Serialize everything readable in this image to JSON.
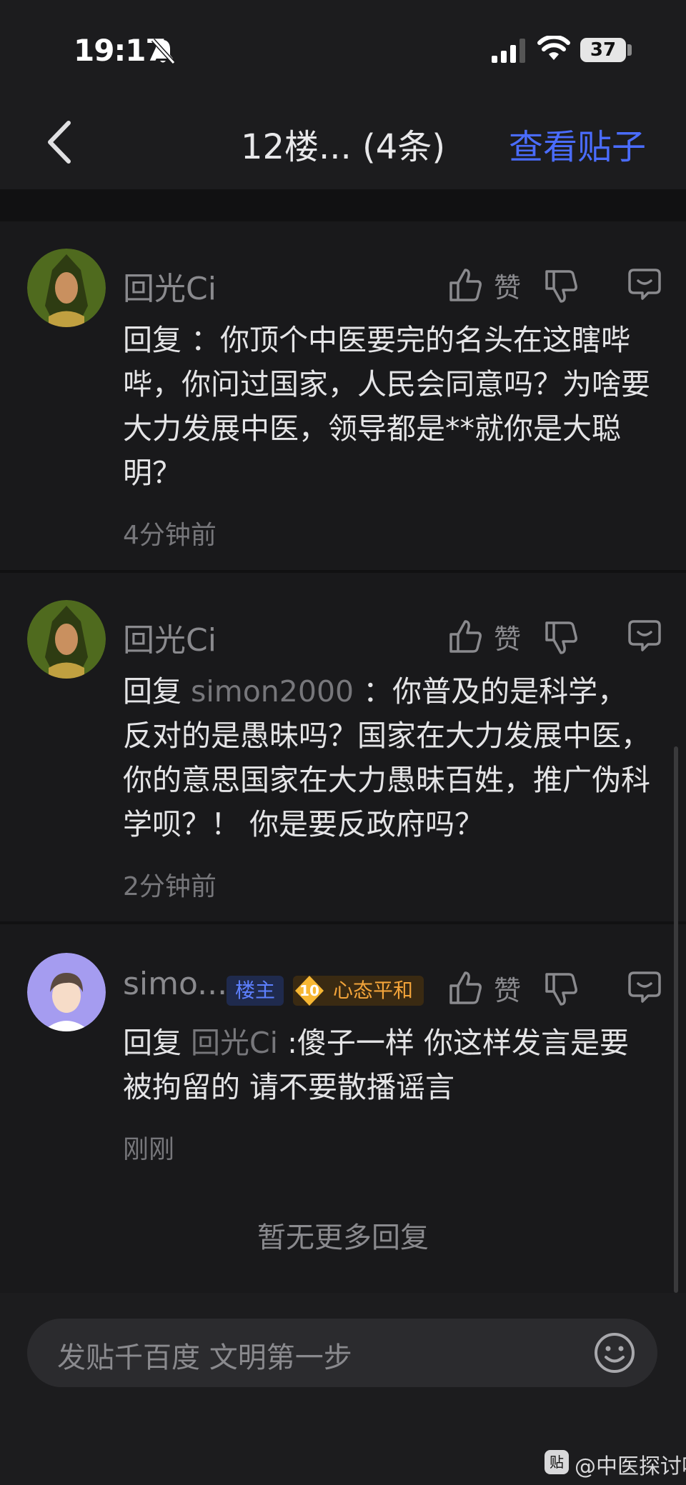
{
  "status": {
    "time": "19:17",
    "battery": "37"
  },
  "nav": {
    "title": "12楼... (4条)",
    "view_post": "查看贴子"
  },
  "comments": [
    {
      "username": "回光Ci",
      "like_label": "赞",
      "reply_prefix": "回复",
      "mention": "",
      "text": " ：你顶个中医要完的名头在这瞎哔哔，你问过国家，人民会同意吗？为啥要大力发展中医，领导都是**就你是大聪明？",
      "time": "4分钟前"
    },
    {
      "username": "回光Ci",
      "like_label": "赞",
      "reply_prefix": "回复",
      "mention": " simon2000",
      "text": " ：你普及的是科学，反对的是愚昧吗？国家在大力发展中医，你的意思国家在大力愚昧百姓，推广伪科学呗？！ 你是要反政府吗？",
      "time": "2分钟前"
    },
    {
      "username": "simo...",
      "badge_op": "楼主",
      "badge_level": "10",
      "badge_title": "心态平和",
      "like_label": "赞",
      "reply_prefix": "回复",
      "mention": " 回光Ci",
      "text": " :傻子一样 你这样发言是要被拘留的 请不要散播谣言",
      "time": "刚刚"
    }
  ],
  "no_more": "暂无更多回复",
  "input": {
    "placeholder": "发贴千百度 文明第一步"
  },
  "watermark": {
    "icon_text": "贴",
    "text": "@中医探讨吧"
  },
  "colors": {
    "accent": "#4a6cff",
    "background": "#111112",
    "card": "#19191b",
    "level_badge": "#f3a43a"
  }
}
